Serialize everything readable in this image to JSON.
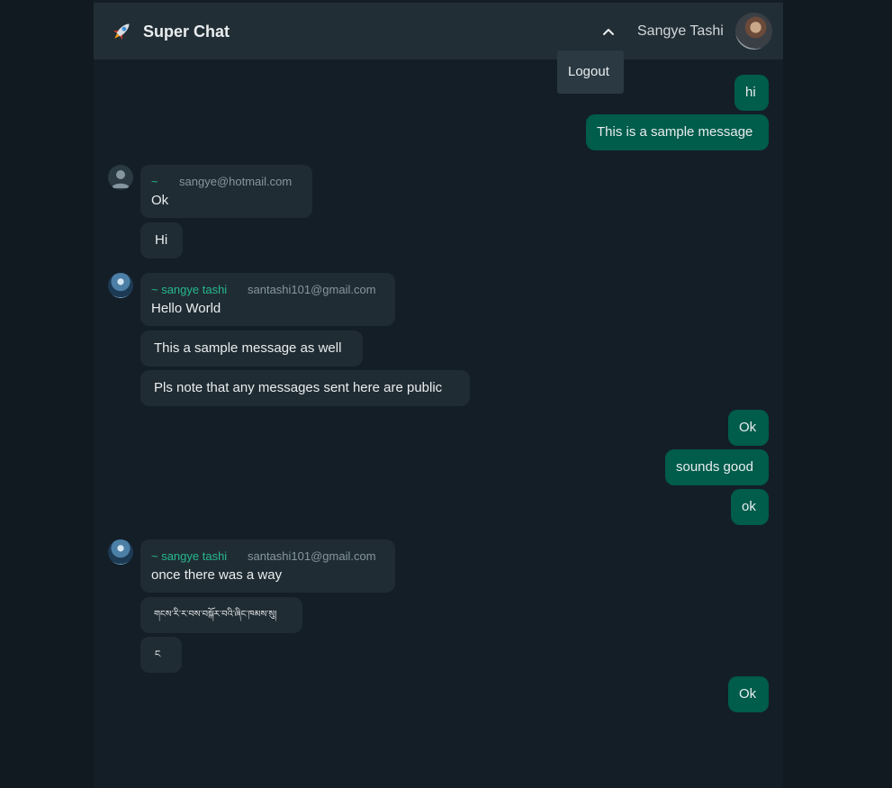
{
  "header": {
    "app_title": "Super Chat",
    "user_name": "Sangye Tashi",
    "logout_label": "Logout"
  },
  "messages": {
    "m1": "hi",
    "m2": "This is a sample message",
    "g1": {
      "sender": "~",
      "email": "sangye@hotmail.com",
      "text": "Ok",
      "followups": [
        "Hi"
      ]
    },
    "g2": {
      "sender": "~ sangye tashi",
      "email": "santashi101@gmail.com",
      "text": "Hello World",
      "followups": [
        "This a sample message as well",
        "Pls note that any messages sent here are public"
      ]
    },
    "m3": "Ok",
    "m4": "sounds good",
    "m5": "ok",
    "g3": {
      "sender": "~ sangye tashi",
      "email": "santashi101@gmail.com",
      "text": "once there was a way",
      "followups": [
        "གངས་རི་ར་བས་བསྐོར་བའི་ཞིང་ཁམས་སུ།",
        "ང"
      ]
    },
    "m6": "Ok"
  }
}
